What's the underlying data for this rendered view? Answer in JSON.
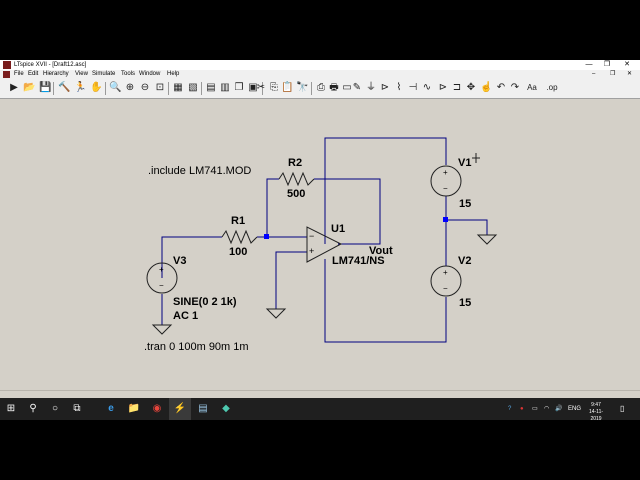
{
  "window": {
    "title": "LTspice XVII - [Draft12.asc]",
    "minimize_glyph": "—",
    "maximize_glyph": "❐",
    "close_glyph": "✕"
  },
  "menu": {
    "items": [
      "File",
      "Edit",
      "Hierarchy",
      "View",
      "Simulate",
      "Tools",
      "Window",
      "Help"
    ],
    "doc_minimize": "–",
    "doc_restore": "❐",
    "doc_close": "✕"
  },
  "toolbar": {
    "icons": [
      {
        "name": "run-icon",
        "glyph": "▶"
      },
      {
        "name": "open-icon",
        "glyph": "📂"
      },
      {
        "name": "save-icon",
        "glyph": "💾"
      },
      {
        "name": "control-panel-icon",
        "glyph": "🔨"
      },
      {
        "name": "run-man-icon",
        "glyph": "🏃"
      },
      {
        "name": "pan-hand-icon",
        "glyph": "✋"
      },
      {
        "name": "zoom-in-icon",
        "glyph": "🔍"
      },
      {
        "name": "zoom-pan-icon",
        "glyph": "⊕"
      },
      {
        "name": "zoom-out-icon",
        "glyph": "⊖"
      },
      {
        "name": "zoom-fit-icon",
        "glyph": "⊡"
      },
      {
        "name": "autoscale-icon",
        "glyph": "▦"
      },
      {
        "name": "delete-traces-icon",
        "glyph": "▧"
      },
      {
        "name": "tile-horizontal-icon",
        "glyph": "▤"
      },
      {
        "name": "tile-vertical-icon",
        "glyph": "▥"
      },
      {
        "name": "cascade-icon",
        "glyph": "❐"
      },
      {
        "name": "close-all-icon",
        "glyph": "▣"
      },
      {
        "name": "cut-icon",
        "glyph": "✂"
      },
      {
        "name": "copy-icon",
        "glyph": "⎘"
      },
      {
        "name": "paste-icon",
        "glyph": "📋"
      },
      {
        "name": "find-icon",
        "glyph": "🔭"
      },
      {
        "name": "print-setup-icon",
        "glyph": "⎙"
      },
      {
        "name": "print-icon",
        "glyph": "🖶"
      },
      {
        "name": "print-preview-icon",
        "glyph": "▭"
      },
      {
        "name": "draw-wire-icon",
        "glyph": "✎"
      },
      {
        "name": "ground-icon",
        "glyph": "⏚"
      },
      {
        "name": "label-net-icon",
        "glyph": "⊳"
      },
      {
        "name": "resistor-icon",
        "glyph": "⌇"
      },
      {
        "name": "capacitor-icon",
        "glyph": "⊣"
      },
      {
        "name": "inductor-icon",
        "glyph": "∿"
      },
      {
        "name": "diode-icon",
        "glyph": "⊳"
      },
      {
        "name": "component-icon",
        "glyph": "⊐"
      },
      {
        "name": "move-icon",
        "glyph": "✥"
      },
      {
        "name": "drag-icon",
        "glyph": "☝"
      },
      {
        "name": "undo-icon",
        "glyph": "↶"
      },
      {
        "name": "redo-icon",
        "glyph": "↷"
      },
      {
        "name": "text-icon",
        "glyph": "Aa"
      },
      {
        "name": "spice-directive-icon",
        "glyph": ".op"
      }
    ]
  },
  "schematic": {
    "directives": {
      "include": ".include LM741.MOD",
      "tran": ".tran 0 100m 90m 1m"
    },
    "components": {
      "r1_name": "R1",
      "r1_value": "100",
      "r2_name": "R2",
      "r2_value": "500",
      "v1_name": "V1",
      "v1_value": "15",
      "v2_name": "V2",
      "v2_value": "15",
      "v3_name": "V3",
      "v3_value": "SINE(0 2 1k)",
      "v3_ac": "AC 1",
      "u1_name": "U1",
      "u1_value": "LM741/NS",
      "vout_label": "Vout",
      "opamp_minus": "−",
      "opamp_plus": "+",
      "source_plus": "+",
      "source_minus": "−"
    },
    "colors": {
      "wire": "#000080",
      "symbol": "#202020",
      "junction": "#0000ff",
      "background": "#d4d0c8"
    }
  },
  "taskbar": {
    "start_glyph": "⊞",
    "search_glyph": "⚲",
    "cortana_glyph": "○",
    "taskview_glyph": "⧉",
    "apps": [
      {
        "name": "edge-icon",
        "glyph": "e"
      },
      {
        "name": "file-explorer-icon",
        "glyph": "📁"
      },
      {
        "name": "chrome-icon",
        "glyph": "◉"
      },
      {
        "name": "ltspice-taskbar-icon",
        "glyph": "⚡"
      },
      {
        "name": "notepad-icon",
        "glyph": "▤"
      },
      {
        "name": "media-app-icon",
        "glyph": "◆"
      }
    ],
    "tray_icons": [
      {
        "name": "help-tray-icon",
        "glyph": "?"
      },
      {
        "name": "security-tray-icon",
        "glyph": "●"
      },
      {
        "name": "battery-tray-icon",
        "glyph": "▭"
      },
      {
        "name": "wifi-tray-icon",
        "glyph": "◠"
      },
      {
        "name": "volume-tray-icon",
        "glyph": "🔊"
      }
    ],
    "language": "ENG",
    "time": "9:47",
    "date": "14-11-2019",
    "notification_glyph": "▯"
  }
}
